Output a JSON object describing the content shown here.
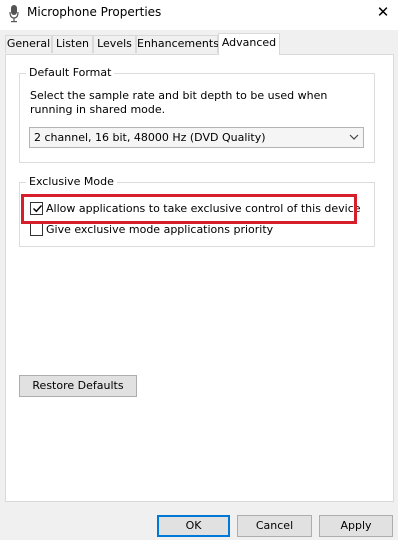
{
  "window": {
    "title": "Microphone Properties",
    "close_glyph": "✕"
  },
  "tabs": [
    {
      "label": "General",
      "active": false
    },
    {
      "label": "Listen",
      "active": false
    },
    {
      "label": "Levels",
      "active": false
    },
    {
      "label": "Enhancements",
      "active": false
    },
    {
      "label": "Advanced",
      "active": true
    }
  ],
  "default_format": {
    "group_label": "Default Format",
    "description": "Select the sample rate and bit depth to be used when running in shared mode.",
    "selected_format": "2 channel, 16 bit, 48000 Hz (DVD Quality)"
  },
  "exclusive_mode": {
    "group_label": "Exclusive Mode",
    "allow_exclusive": {
      "label": "Allow applications to take exclusive control of this device",
      "checked": true
    },
    "give_priority": {
      "label": "Give exclusive mode applications priority",
      "checked": false
    }
  },
  "restore_defaults_label": "Restore Defaults",
  "footer": {
    "ok_label": "OK",
    "cancel_label": "Cancel",
    "apply_label": "Apply"
  },
  "colors": {
    "highlight_border": "#d61f2b",
    "default_button_border": "#0078d7"
  }
}
